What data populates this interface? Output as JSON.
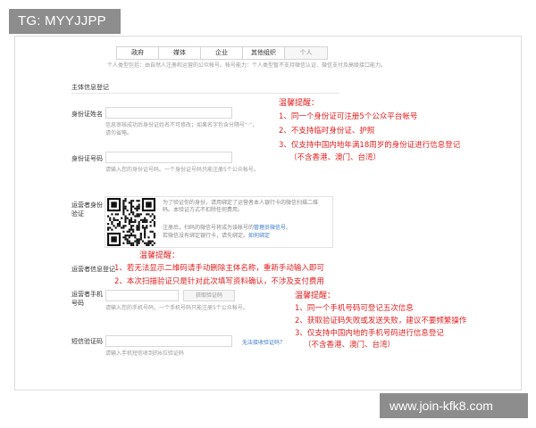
{
  "watermark_top": "TG: MYYJJPP",
  "watermark_bottom": "www.join-kfk8.com",
  "tabs": [
    "政府",
    "媒体",
    "企业",
    "其他组织",
    "个人"
  ],
  "tab_hint": "个人类型包括：由自然人注册和运营的公众帐号。帐号能力：个人类型暂不支持微信认证、微信支付及高级接口能力。",
  "section_title": "主体信息登记",
  "fields": {
    "id_name": {
      "label": "身份证姓名",
      "hint": "信息审核成功后身份证姓名不可修改；如果名字包含分隔号“·”，请勿省略。"
    },
    "id_number": {
      "label": "身份证号码",
      "hint": "请输入您的身份证号码。一个身份证号码只能注册5个公众帐号。"
    },
    "operator_verify": {
      "label_1": "运营者身份",
      "label_2": "验证",
      "qr_text_1": "为了验证你的身份，请用绑定了运营者本人银行卡的微信扫描二维码。本验证方式不扣除任何费用。",
      "qr_text_2_a": "注册后，扫码的微信号将成为该帐号的",
      "qr_text_2_link": "管理员微信号",
      "qr_text_2_b": "。",
      "qr_text_3_a": "若微信没有绑定银行卡，请先绑定。",
      "qr_text_3_link": "如何绑定"
    },
    "operator_info": {
      "label": "运营者信息登记"
    },
    "phone": {
      "label_1": "运营者手机",
      "label_2": "号码",
      "button": "获取验证码",
      "hint": "请输入您的手机号码，一个手机号码只能注册5个公众帐号。"
    },
    "sms_code": {
      "label": "短信验证码",
      "link": "无法接收验证码？",
      "hint": "请输入手机短信收到的6位验证码"
    }
  },
  "notice_1": {
    "head": "温馨提醒：",
    "lines": [
      "1、同一个身份证可注册5个公众平台帐号",
      "2、不支持临时身份证、护照",
      "3、仅支持中国内地年满18周岁的身份证进行信息登记",
      "（不含香港、澳门、台湾）"
    ]
  },
  "notice_2": {
    "head": "温馨提醒：",
    "lines": [
      "1、若无法显示二维码请手动删除主体名称，重新手动输入即可",
      "2、本次扫描验证只是针对此次填写资料确认，不涉及支付费用"
    ]
  },
  "notice_3": {
    "head": "温馨提醒：",
    "lines": [
      "1、同一个手机号码可登记五次信息",
      "2、获取验证码失败或发送失败，建议不要频繁操作",
      "3、仅支持中国内地的手机号码进行信息登记",
      "（不含香港、澳门、台湾）"
    ]
  },
  "colors": {
    "notice_red": "#e02020",
    "link_blue": "#3a79c9",
    "watermark_bg": "#8d8d8d"
  }
}
